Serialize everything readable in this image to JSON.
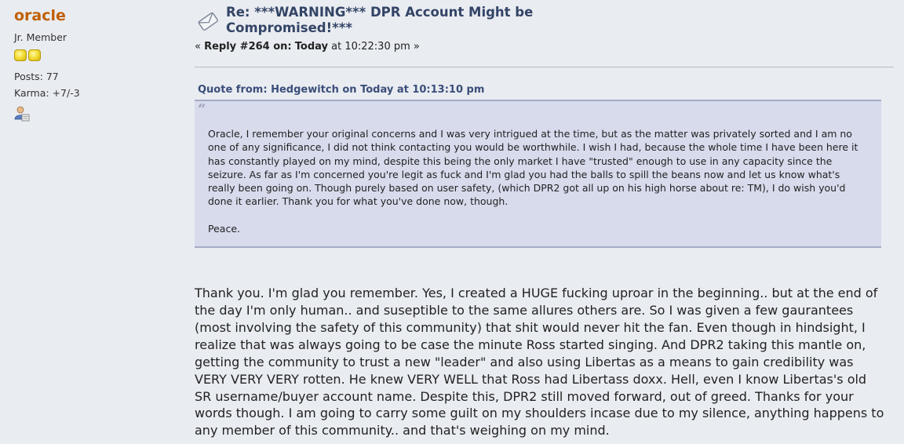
{
  "poster": {
    "name": "oracle",
    "rank": "Jr. Member",
    "posts": "Posts: 77",
    "karma": "Karma: +7/-3",
    "star_count": 2,
    "profile_icon": "profile-icon"
  },
  "post": {
    "subject": "Re: ***WARNING*** DPR Account Might be Compromised!***",
    "reply_prefix": "« ",
    "reply_label": "Reply #264 on:",
    "reply_day": "Today",
    "reply_time": " at 10:22:30 pm »",
    "quote_header": "Quote from: Hedgewitch on Today at 10:13:10 pm",
    "quote_mark": "“",
    "quote_paragraphs": [
      "Oracle, I remember your original concerns and I was very intrigued at the time, but as the matter was privately sorted and I am no one of any significance, I did not think contacting you would be worthwhile. I wish I had, because the whole time I have been here it has constantly played on my mind, despite this being the only market I have \"trusted\" enough to use in any capacity since the seizure. As far as I'm concerned you're legit as fuck and I'm glad you had the balls to spill the beans now and let us know what's really been going on. Though purely based on user safety, (which DPR2 got all up on his high horse about re: TM), I do wish you'd done it earlier. Thank you for what you've done now, though.",
      "Peace."
    ],
    "body": "Thank you. I'm glad you remember. Yes, I created a HUGE fucking uproar in the beginning.. but at the end of the day I'm only human.. and suseptible to the same allures others are. So I was given a few gaurantees (most involving the safety of this community) that shit would never hit the fan. Even though in hindsight, I realize that was always going to be case the minute Ross started singing. And DPR2 taking this mantle on, getting the community to trust a new \"leader\" and also using Libertas as a means to gain credibility was VERY VERY VERY rotten. He knew VERY WELL that Ross had Libertass doxx. Hell, even I know Libertas's old SR username/buyer account name. Despite this, DPR2 still moved forward, out of greed. Thanks for your words though. I am going to carry some guilt on my shoulders incase due to my silence, anything happens to any member of this community.. and that's weighing on my mind."
  },
  "colors": {
    "background": "#e9ecf1",
    "username": "#c06002",
    "subject": "#334466",
    "quote_bg": "#d7dbec",
    "quote_border": "#a5abc5"
  }
}
